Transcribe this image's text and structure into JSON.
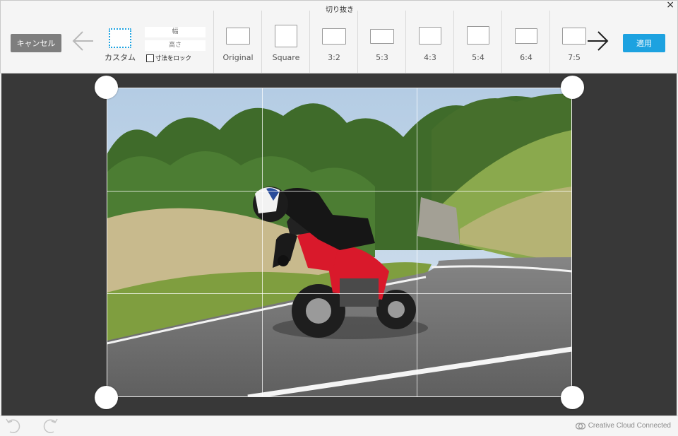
{
  "window": {
    "title": "切り抜き",
    "close": "×"
  },
  "toolbar": {
    "cancel_label": "キャンセル",
    "apply_label": "適用",
    "custom": {
      "label": "カスタム"
    },
    "width_label": "幅",
    "height_label": "高さ",
    "lock_label": "寸法をロック",
    "presets": [
      {
        "label": "Original"
      },
      {
        "label": "Square"
      },
      {
        "label": "3:2"
      },
      {
        "label": "5:3"
      },
      {
        "label": "4:3"
      },
      {
        "label": "5:4"
      },
      {
        "label": "6:4"
      },
      {
        "label": "7:5"
      }
    ]
  },
  "status": {
    "cloud_label": "Creative Cloud Connected"
  },
  "colors": {
    "accent": "#1da2e0",
    "cancel": "#7e7e7e",
    "canvas_bg": "#383838",
    "motorcycle": "#d9192b"
  }
}
